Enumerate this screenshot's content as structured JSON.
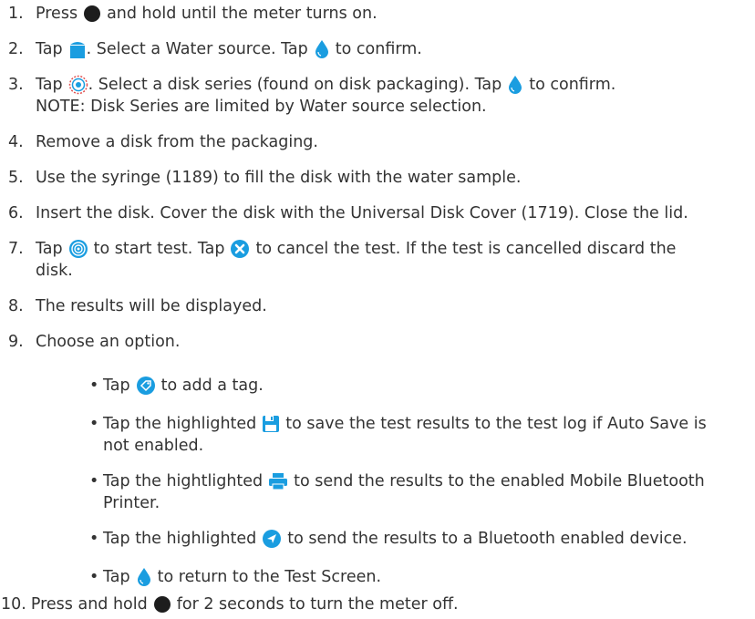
{
  "steps": [
    {
      "num": "1.",
      "before": "Press",
      "icon": "power-button-icon",
      "after": "and hold until the meter turns on."
    },
    {
      "num": "2.",
      "before": "Tap",
      "icon": "water-source-icon",
      "after": ". Select a Water source. Tap",
      "icon2": "water-drop-icon",
      "after2": "to confirm."
    },
    {
      "num": "3.",
      "before": "Tap",
      "icon": "disk-series-icon",
      "after": ". Select a disk series (found on disk packaging). Tap",
      "icon2": "water-drop-icon",
      "after2": "to confirm.",
      "note": "NOTE: Disk Series are limited by Water source selection."
    },
    {
      "num": "4.",
      "text": "Remove a disk from the packaging."
    },
    {
      "num": "5.",
      "text": "Use the syringe (1189) to fill the disk with the water sample."
    },
    {
      "num": "6.",
      "text": "Insert the disk. Cover the disk with the Universal Disk Cover (1719). Close the lid."
    },
    {
      "num": "7.",
      "before": "Tap",
      "icon": "start-test-icon",
      "after": "to start test. Tap",
      "icon2": "cancel-x-icon",
      "after2": "to cancel the test. If the test is cancelled discard the",
      "cont": "disk."
    },
    {
      "num": "8.",
      "text": "The results will be displayed."
    },
    {
      "num": "9.",
      "text": "Choose an option."
    }
  ],
  "options": [
    {
      "before": "Tap",
      "icon": "tag-icon",
      "after": "to add a tag."
    },
    {
      "before": "Tap the highlighted",
      "icon": "save-icon",
      "after": "to save the test results to the test log if Auto Save is",
      "cont": "not enabled."
    },
    {
      "before": "Tap the hightlighted",
      "icon": "printer-icon",
      "after": "to send the results to the enabled Mobile Bluetooth",
      "cont": "Printer."
    },
    {
      "before": "Tap the highlighted",
      "icon": "send-icon",
      "after": "to send the results to a Bluetooth enabled device."
    },
    {
      "before": "Tap",
      "icon": "water-drop-icon",
      "after": "to return to the Test Screen."
    }
  ],
  "bullet_char": "•",
  "final_step": {
    "num": "10.",
    "before": "Press and hold",
    "icon": "power-button-icon",
    "after": "for 2 seconds to turn the meter off."
  },
  "colors": {
    "text": "#333333",
    "blue": "#1a9de0",
    "dark": "#1d1d1d"
  }
}
